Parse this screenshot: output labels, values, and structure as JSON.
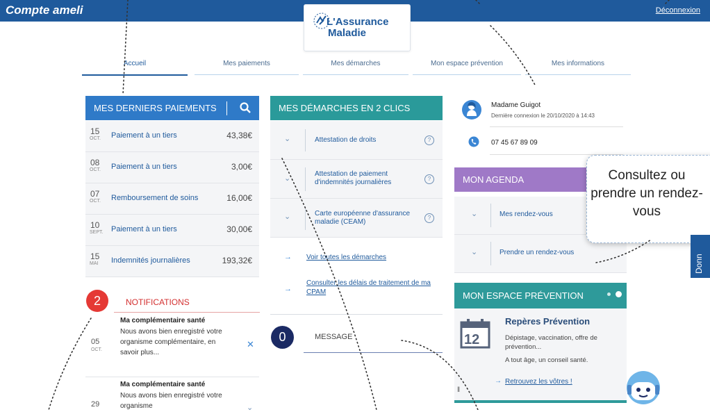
{
  "header": {
    "app_title": "Compte ameli",
    "logout_label": "Déconnexion",
    "logo_line1": "L'Assurance",
    "logo_line2": "Maladie"
  },
  "tabs": [
    {
      "label": "Accueil",
      "active": true
    },
    {
      "label": "Mes paiements"
    },
    {
      "label": "Mes démarches"
    },
    {
      "label": "Mon espace prévention"
    },
    {
      "label": "Mes informations"
    }
  ],
  "payments": {
    "title": "MES DERNIERS PAIEMENTS",
    "rows": [
      {
        "day": "15",
        "month": "OCT.",
        "label": "Paiement à un tiers",
        "amount": "43,38€"
      },
      {
        "day": "08",
        "month": "OCT.",
        "label": "Paiement à un tiers",
        "amount": "3,00€"
      },
      {
        "day": "07",
        "month": "OCT.",
        "label": "Remboursement de soins",
        "amount": "16,00€"
      },
      {
        "day": "10",
        "month": "SEPT.",
        "label": "Paiement à un tiers",
        "amount": "30,00€"
      },
      {
        "day": "15",
        "month": "MAI",
        "label": "Indemnités journalières",
        "amount": "193,32€"
      }
    ]
  },
  "notifications": {
    "count": "2",
    "title": "NOTIFICATIONS",
    "items": [
      {
        "day": "05",
        "month": "OCT.",
        "title": "Ma complémentaire santé",
        "text": "Nous avons bien enregistré votre organisme complémentaire, en savoir plus..."
      },
      {
        "day": "29",
        "month": "",
        "title": "Ma complémentaire santé",
        "text": "Nous avons bien enregistré votre organisme"
      }
    ]
  },
  "demarches": {
    "title": "MES DÉMARCHES EN 2 CLICS",
    "items": [
      {
        "label": "Attestation de droits"
      },
      {
        "label": "Attestation de paiement d'indemnités journalières"
      },
      {
        "label": "Carte européenne d'assurance maladie (CEAM)"
      }
    ],
    "links": [
      {
        "label": "Voir toutes les démarches"
      },
      {
        "label": "Consulter les délais de traitement de ma CPAM"
      }
    ]
  },
  "message": {
    "count": "0",
    "label": "MESSAGE"
  },
  "profile": {
    "name": "Madame Guigot",
    "last_login": "Dernière connexion le 20/10/2020 à 14:43",
    "phone": "07 45 67 89 09"
  },
  "agenda": {
    "title": "MON AGENDA",
    "items": [
      {
        "label": "Mes rendez-vous"
      },
      {
        "label": "Prendre un rendez-vous"
      }
    ]
  },
  "prevention": {
    "title": "MON ESPACE PRÉVENTION",
    "calendar_day": "12",
    "heading": "Repères Prévention",
    "text1": "Dépistage, vaccination, offre de prévention...",
    "text2": "A tout âge, un conseil santé.",
    "link": "Retrouvez les vôtres !"
  },
  "callout": {
    "text": "Consultez ou prendre un rendez-vous"
  },
  "side_tab": {
    "label": "Donn"
  },
  "colors": {
    "header_blue": "#1f5a9c",
    "payments_head": "#2f7ac8",
    "demarches_head": "#2a9a9a",
    "agenda_head": "#9f79c7",
    "prevention_head": "#2e9a9a",
    "notif_red": "#e53935",
    "msg_navy": "#1b2a64"
  }
}
